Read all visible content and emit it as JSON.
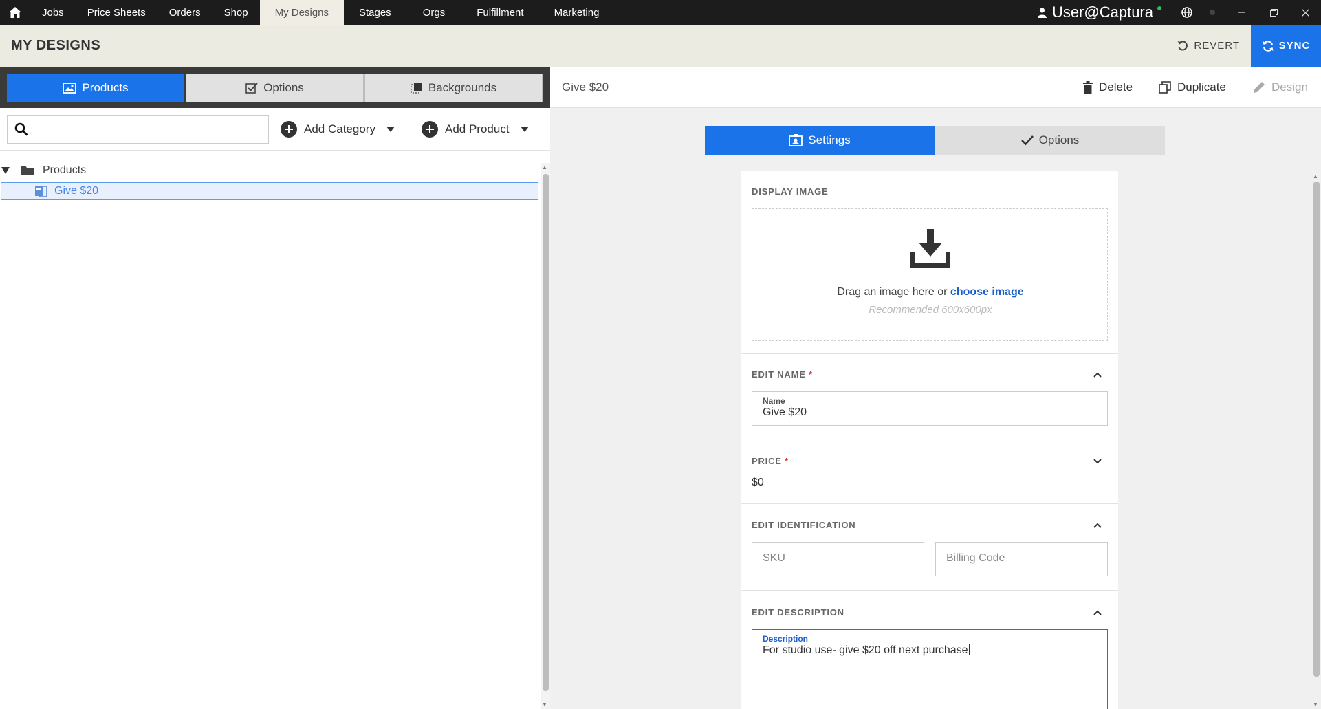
{
  "nav": {
    "items": [
      "Jobs",
      "Price Sheets",
      "Orders",
      "Shop",
      "My Designs",
      "Stages",
      "Orgs",
      "Fulfillment",
      "Marketing"
    ],
    "active": "My Designs",
    "user": "User@Captura"
  },
  "header": {
    "title": "MY DESIGNS",
    "revert_label": "REVERT",
    "sync_label": "SYNC"
  },
  "left": {
    "tabs": [
      "Products",
      "Options",
      "Backgrounds"
    ],
    "active_tab": "Products",
    "search": {
      "placeholder": "",
      "value": ""
    },
    "add_category_label": "Add Category",
    "add_product_label": "Add Product",
    "tree": {
      "root_label": "Products",
      "children": [
        "Give $20"
      ]
    }
  },
  "right": {
    "title": "Give $20",
    "actions": {
      "delete": "Delete",
      "duplicate": "Duplicate",
      "design": "Design"
    },
    "subtabs": [
      "Settings",
      "Options"
    ],
    "active_subtab": "Settings",
    "display_image": {
      "title": "DISPLAY IMAGE",
      "drag_text": "Drag an image here or",
      "choose_link": "choose image",
      "hint": "Recommended 600x600px"
    },
    "edit_name": {
      "title": "EDIT NAME",
      "label": "Name",
      "value": "Give $20"
    },
    "price": {
      "title": "PRICE",
      "value": "$0"
    },
    "identification": {
      "title": "EDIT IDENTIFICATION",
      "sku_placeholder": "SKU",
      "billing_placeholder": "Billing Code"
    },
    "description": {
      "title": "EDIT DESCRIPTION",
      "label": "Description",
      "value": "For studio use- give $20 off next purchase"
    }
  },
  "colors": {
    "accent": "#1a73e8",
    "topnav": "#1c1c1c",
    "header": "#ecebe2",
    "required": "#d32f2f"
  }
}
